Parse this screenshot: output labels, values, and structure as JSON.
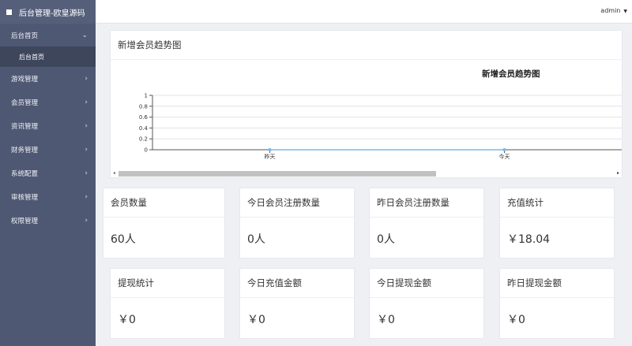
{
  "brand": {
    "title": "后台管理-欧皇源码"
  },
  "sidebar": {
    "items": [
      {
        "label": "后台首页",
        "chevron": "⌄",
        "open": true
      },
      {
        "label": "游戏管理",
        "chevron": "›"
      },
      {
        "label": "会员管理",
        "chevron": "›"
      },
      {
        "label": "资讯管理",
        "chevron": "›"
      },
      {
        "label": "财务管理",
        "chevron": "›"
      },
      {
        "label": "系统配置",
        "chevron": "›"
      },
      {
        "label": "审核管理",
        "chevron": "›"
      },
      {
        "label": "权限管理",
        "chevron": "›"
      }
    ],
    "sub_items": [
      {
        "label": "后台首页"
      }
    ]
  },
  "topbar": {
    "user": "admin",
    "caret": "▼"
  },
  "chart_panel": {
    "heading": "新增会员趋势图",
    "scroll_left": "◂",
    "scroll_right": "▸"
  },
  "chart_data": {
    "type": "line",
    "title": "新增会员趋势图",
    "categories": [
      "昨天",
      "今天"
    ],
    "series": [
      {
        "values": [
          0,
          0
        ]
      }
    ],
    "yticks": [
      "0",
      "0.2",
      "0.4",
      "0.6",
      "0.8",
      "1"
    ],
    "ylim": [
      0,
      1
    ],
    "grid": true
  },
  "stats": [
    {
      "title": "会员数量",
      "value": "60人"
    },
    {
      "title": "今日会员注册数量",
      "value": "0人"
    },
    {
      "title": "昨日会员注册数量",
      "value": "0人"
    },
    {
      "title": "充值统计",
      "value": "￥18.04"
    },
    {
      "title": "提现统计",
      "value": "￥0"
    },
    {
      "title": "今日充值金额",
      "value": "￥0"
    },
    {
      "title": "今日提现金额",
      "value": "￥0"
    },
    {
      "title": "昨日提现金额",
      "value": "￥0"
    }
  ]
}
